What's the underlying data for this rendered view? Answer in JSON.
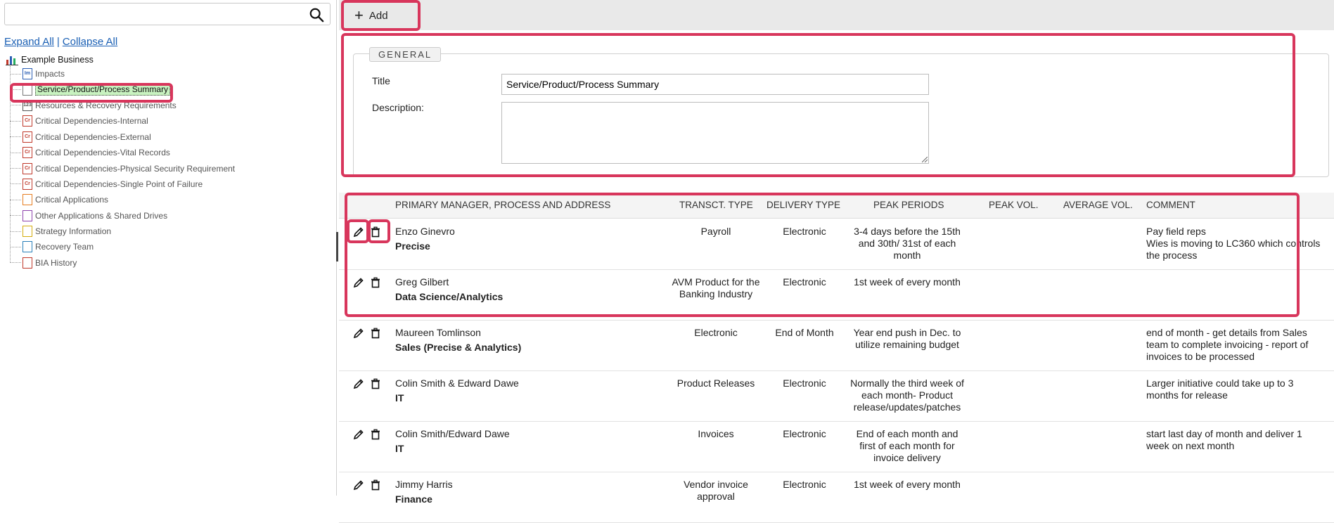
{
  "left": {
    "search": {
      "value": "",
      "placeholder": ""
    },
    "expand_all": "Expand All",
    "separator": "|",
    "collapse_all": "Collapse All",
    "root_label": "Example Business",
    "items": [
      {
        "label": "Impacts",
        "badge": "Im",
        "color": "#2b5fb4"
      },
      {
        "label": "Service/Product/Process Summary",
        "badge": "",
        "color": "#777777",
        "selected": true
      },
      {
        "label": "Resources & Recovery Requirements",
        "badge": "123",
        "color": "#555555"
      },
      {
        "label": "Critical Dependencies-Internal",
        "badge": "Cr",
        "color": "#c0392b"
      },
      {
        "label": "Critical Dependencies-External",
        "badge": "Cr",
        "color": "#c0392b"
      },
      {
        "label": "Critical Dependencies-Vital Records",
        "badge": "Cr",
        "color": "#c0392b"
      },
      {
        "label": "Critical Dependencies-Physical Security Requirement",
        "badge": "Cr",
        "color": "#c0392b"
      },
      {
        "label": "Critical Dependencies-Single Point of Failure",
        "badge": "Cr",
        "color": "#c0392b"
      },
      {
        "label": "Critical Applications",
        "badge": "",
        "color": "#e67e22"
      },
      {
        "label": "Other Applications & Shared Drives",
        "badge": "",
        "color": "#8e44ad"
      },
      {
        "label": "Strategy Information",
        "badge": "",
        "color": "#d4ac0d"
      },
      {
        "label": "Recovery Team",
        "badge": "",
        "color": "#2980b9"
      },
      {
        "label": "BIA History",
        "badge": "",
        "color": "#c0392b"
      }
    ]
  },
  "toolbar": {
    "add_label": "Add"
  },
  "general": {
    "legend": "GENERAL",
    "title_label": "Title",
    "title_value": "Service/Product/Process Summary",
    "description_label": "Description:",
    "description_value": ""
  },
  "table": {
    "headers": {
      "manager": "PRIMARY MANAGER, PROCESS AND ADDRESS",
      "transct": "TRANSCT. TYPE",
      "delivery": "DELIVERY TYPE",
      "peak_periods": "PEAK PERIODS",
      "peak_vol": "PEAK VOL.",
      "avg_vol": "AVERAGE VOL.",
      "comment": "COMMENT"
    },
    "rows": [
      {
        "name": "Enzo Ginevro",
        "dept": "Precise",
        "transct": "Payroll",
        "delivery": "Electronic",
        "peak": "3-4 days before the 15th and 30th/ 31st of each month",
        "peak_vol": "",
        "avg_vol": "",
        "comment": "Pay field reps\nWies is moving to LC360 which controls the process"
      },
      {
        "name": "Greg Gilbert",
        "dept": "Data Science/Analytics",
        "transct": "AVM Product for the Banking Industry",
        "delivery": "Electronic",
        "peak": "1st week of every month",
        "peak_vol": "",
        "avg_vol": "",
        "comment": ""
      },
      {
        "name": "Maureen Tomlinson",
        "dept": "Sales (Precise & Analytics)",
        "transct": "Electronic",
        "delivery": "End of Month",
        "peak": "Year end push in Dec. to utilize remaining budget",
        "peak_vol": "",
        "avg_vol": "",
        "comment": "end of month - get details from Sales team to complete invoicing - report of invoices to be processed"
      },
      {
        "name": "Colin Smith & Edward Dawe",
        "dept": "IT",
        "transct": "Product Releases",
        "delivery": "Electronic",
        "peak": "Normally the third week of each month- Product release/updates/patches",
        "peak_vol": "",
        "avg_vol": "",
        "comment": "Larger initiative could take up to 3 months for release"
      },
      {
        "name": "Colin Smith/Edward Dawe",
        "dept": "IT",
        "transct": "Invoices",
        "delivery": "Electronic",
        "peak": "End of each month and first of each month for invoice delivery",
        "peak_vol": "",
        "avg_vol": "",
        "comment": "start last day of month and deliver 1 week on next month"
      },
      {
        "name": "Jimmy Harris",
        "dept": "Finance",
        "transct": "Vendor invoice approval",
        "delivery": "Electronic",
        "peak": "1st week of every month",
        "peak_vol": "",
        "avg_vol": "",
        "comment": ""
      }
    ]
  },
  "colors": {
    "highlight": "#d8365c",
    "link": "#1a5fb4",
    "selected_bg": "#c8f2c0"
  }
}
